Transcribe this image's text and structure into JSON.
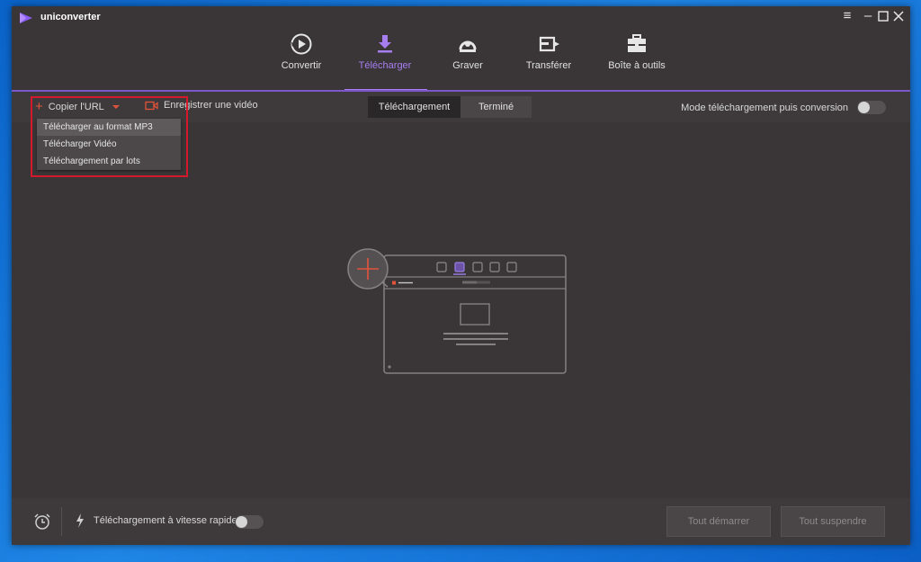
{
  "app": {
    "title": "uniconverter"
  },
  "nav": {
    "tabs": [
      {
        "label": "Convertir",
        "icon": "convert-icon"
      },
      {
        "label": "Télécharger",
        "icon": "download-icon",
        "active": true
      },
      {
        "label": "Graver",
        "icon": "burn-disc-icon"
      },
      {
        "label": "Transférer",
        "icon": "transfer-icon"
      },
      {
        "label": "Boîte à outils",
        "icon": "toolbox-icon"
      }
    ]
  },
  "toolbar": {
    "copy_url": "Copier l'URL",
    "record_video": "Enregistrer une vidéo",
    "segments": [
      "Téléchargement",
      "Terminé"
    ],
    "mode_label": "Mode téléchargement puis conversion"
  },
  "dropdown": {
    "items": [
      "Télécharger au format MP3",
      "Télécharger Vidéo",
      "Téléchargement par lots"
    ]
  },
  "footer": {
    "speed_label": "Téléchargement à vitesse rapide",
    "start_all": "Tout démarrer",
    "pause_all": "Tout suspendre"
  },
  "colors": {
    "accent": "#a77ef0",
    "nav_line": "#7c57c9",
    "plus": "#e2533b",
    "highlight": "#d3192b",
    "background": "#3a3637"
  }
}
